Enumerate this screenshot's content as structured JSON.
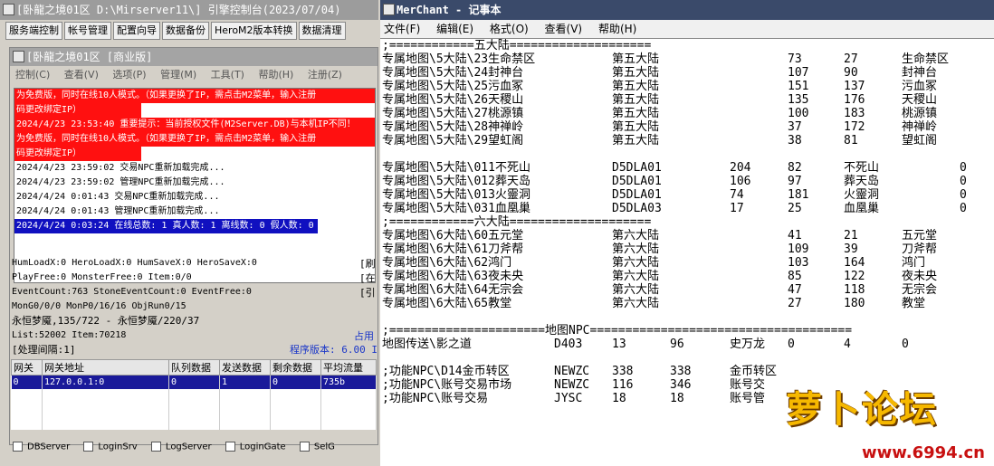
{
  "engine": {
    "title": "[卧龍之境01区 D:\\Mirserver11\\] 引擎控制台(2023/07/04)",
    "tabs": [
      "服务端控制",
      "帐号管理",
      "配置向导",
      "数据备份",
      "HeroM2版本转换",
      "数据清理"
    ],
    "inner_title": "[卧龍之境01区 [商业版]",
    "menu": [
      "控制(C)",
      "查看(V)",
      "选项(P)",
      "管理(M)",
      "工具(T)",
      "帮助(H)",
      "注册(Z)"
    ],
    "log": [
      {
        "text": "为免费版，同时在线10人模式。（如果更换了IP，需点击M2菜单，输入注册",
        "style": "red"
      },
      {
        "text": "码更改绑定IP）",
        "style": "red"
      },
      {
        "text": "2024/4/23 23:53:40 重要提示：当前授权文件(M2Server.DB)与本机IP不同！",
        "style": "red"
      },
      {
        "text": "为免费版，同时在线10人模式。（如果更换了IP，需点击M2菜单，输入注册",
        "style": "red"
      },
      {
        "text": "码更改绑定IP）",
        "style": "red"
      },
      {
        "text": "2024/4/23 23:59:02 交易NPC重新加载完成...",
        "style": ""
      },
      {
        "text": "2024/4/23 23:59:02 管理NPC重新加载完成...",
        "style": ""
      },
      {
        "text": "2024/4/24 0:01:43 交易NPC重新加载完成...",
        "style": ""
      },
      {
        "text": "2024/4/24 0:01:43 管理NPC重新加载完成...",
        "style": ""
      },
      {
        "text": "2024/4/24 0:03:24 在线总数: 1 真人数: 1 离线数: 0 假人数: 0",
        "style": "blue"
      }
    ],
    "stats": [
      "HumLoadX:0 HeroLoadX:0 HumSaveX:0 HeroSaveX:0",
      "PlayFree:0 MonsterFree:0 Item:0/0",
      "EventCount:763 StoneEventCount:0 EventFree:0",
      "MonG0/0/0 MonP0/16/16 ObjRun0/15",
      "永恒梦魇,135/722 - 永恒梦魇/220/37",
      "List:52002 Item:70218"
    ],
    "side_buttons": [
      "[刷",
      "[在",
      "[引"
    ],
    "occupy_label": "占用",
    "interval_label": "[处理间隔:1]",
    "version_label": "程序版本: 6.00 I",
    "gateway": {
      "headers": [
        "网关",
        "网关地址",
        "队列数据",
        "发送数据",
        "剩余数据",
        "平均流量"
      ],
      "rows": [
        [
          "0",
          "127.0.0.1:0",
          "0",
          "1",
          "0",
          "735b"
        ]
      ]
    },
    "checkboxes": [
      "DBServer",
      "LoginSrv",
      "LogServer",
      "LoginGate",
      "SelG"
    ]
  },
  "notepad": {
    "title": "MerChant - 记事本",
    "menu": [
      "文件(F)",
      "编辑(E)",
      "格式(O)",
      "查看(V)",
      "帮助(H)"
    ],
    "section1": ";============五大陆====================",
    "block1": [
      [
        "专属地图\\5大陆\\23生命禁区",
        "第五大陆",
        "73",
        "27",
        "生命禁区",
        ""
      ],
      [
        "专属地图\\5大陆\\24封神台",
        "第五大陆",
        "107",
        "90",
        "封神台",
        ""
      ],
      [
        "专属地图\\5大陆\\25污血冢",
        "第五大陆",
        "151",
        "137",
        "污血冢",
        ""
      ],
      [
        "专属地图\\5大陆\\26天稷山",
        "第五大陆",
        "135",
        "176",
        "天稷山",
        ""
      ],
      [
        "专属地图\\5大陆\\27桃源镇",
        "第五大陆",
        "100",
        "183",
        "桃源镇",
        ""
      ],
      [
        "专属地图\\5大陆\\28神禅岭",
        "第五大陆",
        "37",
        "172",
        "神禅岭",
        ""
      ],
      [
        "专属地图\\5大陆\\29望虹阁",
        "第五大陆",
        "38",
        "81",
        "望虹阁",
        ""
      ]
    ],
    "block2": [
      [
        "专属地图\\5大陆\\011不死山",
        "D5DLA01",
        "204",
        "82",
        "不死山",
        "0"
      ],
      [
        "专属地图\\5大陆\\012葬天岛",
        "D5DLA01",
        "106",
        "97",
        "葬天岛",
        "0"
      ],
      [
        "专属地图\\5大陆\\013火靈洞",
        "D5DLA01",
        "74",
        "181",
        "火靈洞",
        "0"
      ],
      [
        "专属地图\\5大陆\\031血凰巢",
        "D5DLA03",
        "17",
        "25",
        "血凰巢",
        "0"
      ]
    ],
    "section2": ";============六大陆====================",
    "block3": [
      [
        "专属地图\\6大陆\\60五元堂",
        "第六大陆",
        "41",
        "21",
        "五元堂"
      ],
      [
        "专属地图\\6大陆\\61刀斧帮",
        "第六大陆",
        "109",
        "39",
        "刀斧帮"
      ],
      [
        "专属地图\\6大陆\\62鸿门",
        "第六大陆",
        "103",
        "164",
        "鸿门"
      ],
      [
        "专属地图\\6大陆\\63夜未央",
        "第六大陆",
        "85",
        "122",
        "夜未央"
      ],
      [
        "专属地图\\6大陆\\64无宗会",
        "第六大陆",
        "47",
        "118",
        "无宗会"
      ],
      [
        "专属地图\\6大陆\\65教堂",
        "第六大陆",
        "27",
        "180",
        "教堂"
      ]
    ],
    "section3": ";======================地图NPC=====================================",
    "npc1": [
      "地图传送\\影之道",
      "D403",
      "13",
      "96",
      "史万龙",
      "0",
      "4",
      "0"
    ],
    "npc_block": [
      [
        ";功能NPC\\D14金币转区",
        "NEWZC",
        "338",
        "338",
        "金币转区"
      ],
      [
        ";功能NPC\\账号交易市场",
        "NEWZC",
        "116",
        "346",
        "账号交"
      ],
      [
        ";功能NPC\\账号交易",
        "JYSC",
        "18",
        "18",
        "账号管"
      ]
    ]
  },
  "watermark": {
    "text": "萝卜论坛",
    "url": "www.6994.cn"
  }
}
